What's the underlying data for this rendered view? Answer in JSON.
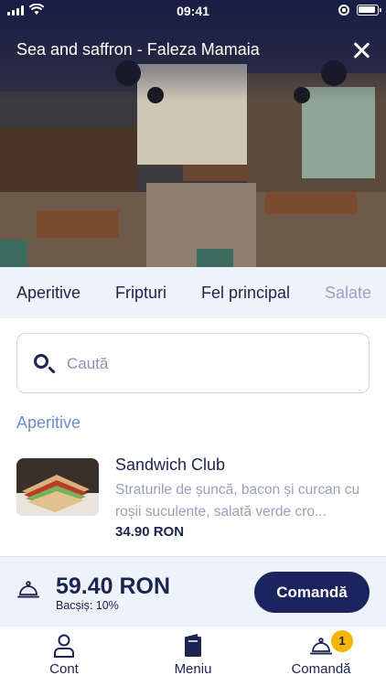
{
  "status_bar": {
    "time": "09:41"
  },
  "header": {
    "title": "Sea and saffron - Faleza Mamaia"
  },
  "categories": [
    "Aperitive",
    "Fripturi",
    "Fel principal",
    "Salate"
  ],
  "search": {
    "placeholder": "Caută",
    "value": ""
  },
  "section": {
    "title": "Aperitive"
  },
  "items": [
    {
      "name": "Sandwich Club",
      "description": "Straturile de șuncă, bacon și curcan cu roșii suculente, salată verde cro...",
      "price": "34.90 RON"
    }
  ],
  "order_bar": {
    "total": "59.40 RON",
    "tip": "Bacșiș: 10%",
    "button_label": "Comandă"
  },
  "bottom_nav": [
    {
      "label": "Cont",
      "icon": "user-icon"
    },
    {
      "label": "Meniu",
      "icon": "menu-book-icon"
    },
    {
      "label": "Comandă",
      "icon": "cloche-icon",
      "badge": "1"
    }
  ],
  "colors": {
    "primary": "#1c2460",
    "accent": "#f4b400",
    "section_title": "#6b8fd1",
    "bar_background": "#eef2fb"
  }
}
